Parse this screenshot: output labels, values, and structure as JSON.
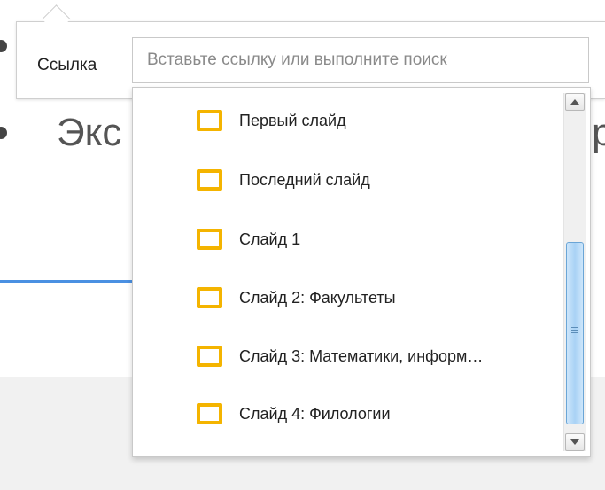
{
  "background": {
    "heading_fragment": "Экс",
    "right_fragment": "р"
  },
  "link_dialog": {
    "label": "Ссылка",
    "input_placeholder": "Вставьте ссылку или выполните поиск",
    "input_value": ""
  },
  "dropdown": {
    "items": [
      {
        "label": "Первый слайд",
        "icon": "slide-icon"
      },
      {
        "label": "Последний слайд",
        "icon": "slide-icon"
      },
      {
        "label": "Слайд 1",
        "icon": "slide-icon"
      },
      {
        "label": "Слайд 2: Факультеты",
        "icon": "slide-icon"
      },
      {
        "label": "Слайд 3: Математики, информ…",
        "icon": "slide-icon"
      },
      {
        "label": "Слайд 4: Филологии",
        "icon": "slide-icon"
      }
    ]
  },
  "colors": {
    "slide_icon": "#f4b400",
    "scroll_thumb": "#a9d2f5",
    "accent_line": "#4a90e2"
  }
}
